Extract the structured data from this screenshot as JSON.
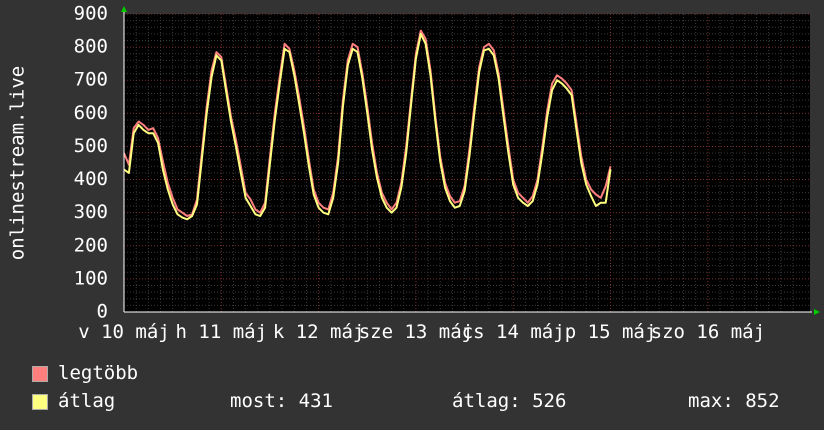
{
  "chart_data": {
    "type": "line",
    "ylabel": "onlinestream.live",
    "ylim": [
      0,
      900
    ],
    "yticks": [
      0,
      100,
      200,
      300,
      400,
      500,
      600,
      700,
      800,
      900
    ],
    "xlim": [
      0,
      7.05
    ],
    "xticks": [
      {
        "x": 0,
        "label": "v 10 máj"
      },
      {
        "x": 1,
        "label": "h 11 máj"
      },
      {
        "x": 2,
        "label": "k 12 máj"
      },
      {
        "x": 3,
        "label": "sze 13 máj"
      },
      {
        "x": 4,
        "label": "cs 14 máj"
      },
      {
        "x": 5,
        "label": "p 15 máj"
      },
      {
        "x": 6,
        "label": "szo 16 máj"
      }
    ],
    "grid": true,
    "x": [
      0.0,
      0.05,
      0.1,
      0.15,
      0.2,
      0.25,
      0.3,
      0.35,
      0.4,
      0.45,
      0.5,
      0.55,
      0.6,
      0.65,
      0.7,
      0.75,
      0.8,
      0.85,
      0.9,
      0.95,
      1.0,
      1.05,
      1.1,
      1.15,
      1.2,
      1.25,
      1.3,
      1.35,
      1.4,
      1.45,
      1.5,
      1.55,
      1.6,
      1.65,
      1.7,
      1.75,
      1.8,
      1.85,
      1.9,
      1.95,
      2.0,
      2.05,
      2.1,
      2.15,
      2.2,
      2.25,
      2.3,
      2.35,
      2.4,
      2.45,
      2.5,
      2.55,
      2.6,
      2.65,
      2.7,
      2.75,
      2.8,
      2.85,
      2.9,
      2.95,
      3.0,
      3.05,
      3.1,
      3.15,
      3.2,
      3.25,
      3.3,
      3.35,
      3.4,
      3.45,
      3.5,
      3.55,
      3.6,
      3.65,
      3.7,
      3.75,
      3.8,
      3.85,
      3.9,
      3.95,
      4.0,
      4.05,
      4.1,
      4.15,
      4.2,
      4.25,
      4.3,
      4.35,
      4.4,
      4.45,
      4.5,
      4.55,
      4.6,
      4.65,
      4.7,
      4.75,
      4.8,
      4.85,
      4.9,
      4.95,
      5.0,
      5.05,
      5.1,
      5.15,
      5.2,
      5.25,
      5.3,
      5.35,
      5.4,
      5.45,
      5.5,
      5.55,
      5.6,
      5.65,
      5.7,
      5.75,
      5.8,
      5.85,
      5.9,
      5.95,
      6.0,
      6.05,
      6.1,
      6.15,
      6.2,
      6.25,
      6.3,
      6.35,
      6.4,
      6.45,
      6.5,
      6.55,
      6.6,
      6.65,
      6.7,
      6.75,
      6.8,
      6.85,
      6.9,
      6.95,
      7.0,
      7.05
    ],
    "series": [
      {
        "name": "legtöbb",
        "color": "#ff7f7f",
        "values": [
          480,
          445,
          555,
          575,
          565,
          550,
          555,
          525,
          455,
          390,
          345,
          310,
          300,
          290,
          295,
          340,
          480,
          620,
          730,
          785,
          770,
          680,
          590,
          520,
          440,
          360,
          340,
          310,
          300,
          330,
          470,
          600,
          710,
          810,
          795,
          730,
          650,
          560,
          460,
          370,
          330,
          315,
          310,
          360,
          470,
          640,
          760,
          810,
          800,
          720,
          620,
          510,
          420,
          360,
          330,
          310,
          330,
          390,
          500,
          640,
          780,
          850,
          825,
          730,
          590,
          470,
          390,
          350,
          330,
          335,
          380,
          490,
          620,
          740,
          800,
          810,
          790,
          720,
          610,
          500,
          400,
          360,
          345,
          330,
          350,
          400,
          500,
          610,
          690,
          715,
          705,
          690,
          670,
          570,
          470,
          400,
          370,
          355,
          345,
          380,
          440
        ]
      },
      {
        "name": "átlag",
        "color": "#ffff80",
        "values": [
          430,
          420,
          540,
          565,
          550,
          540,
          540,
          510,
          430,
          370,
          325,
          295,
          285,
          280,
          290,
          325,
          460,
          600,
          710,
          775,
          760,
          665,
          575,
          500,
          420,
          345,
          320,
          295,
          290,
          315,
          450,
          580,
          690,
          795,
          785,
          715,
          630,
          540,
          440,
          355,
          315,
          300,
          295,
          345,
          450,
          620,
          745,
          795,
          785,
          705,
          600,
          490,
          405,
          345,
          315,
          300,
          315,
          375,
          480,
          625,
          765,
          840,
          810,
          715,
          575,
          455,
          375,
          335,
          315,
          320,
          365,
          470,
          600,
          725,
          790,
          795,
          775,
          705,
          590,
          480,
          385,
          345,
          330,
          320,
          335,
          385,
          480,
          590,
          670,
          700,
          690,
          675,
          655,
          550,
          450,
          385,
          350,
          320,
          330,
          330,
          431
        ]
      }
    ]
  },
  "legend": {
    "items": [
      {
        "label": "legtöbb",
        "color": "#ff7f7f"
      },
      {
        "label": "átlag",
        "color": "#ffff80"
      }
    ]
  },
  "stats": {
    "most": "most: 431",
    "atlag": "átlag: 526",
    "max": "max: 852"
  }
}
